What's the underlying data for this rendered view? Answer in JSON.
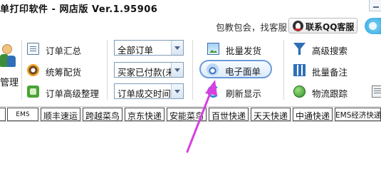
{
  "window": {
    "title": "单打印软件 - 网店版 Ver.1.95906",
    "minimize_icon": "minimize-icon"
  },
  "support": {
    "promo_text": "包教包会，找客服",
    "qq_button_label": "联系QQ客服",
    "qq_icon": "qq-penguin-icon"
  },
  "toolbar": {
    "manage_label": "管理",
    "left_tools": [
      {
        "label": "订单汇总",
        "icon": "document-list-icon"
      },
      {
        "label": "统筹配货",
        "icon": "gear-icon"
      },
      {
        "label": "订单高级整理",
        "icon": "organize-icon"
      }
    ],
    "filters": [
      {
        "value": "全部订单"
      },
      {
        "value": "买家已付款(未"
      },
      {
        "value": "订单成交时间,"
      }
    ],
    "middle_tools": [
      {
        "label": "批量发货",
        "icon": "image-icon"
      },
      {
        "label": "电子面单",
        "icon": "scanner-icon"
      },
      {
        "label": "刷新显示",
        "icon": "refresh-icon"
      }
    ],
    "right_tools": [
      {
        "label": "高级搜索",
        "icon": "funnel-icon"
      },
      {
        "label": "批量备注",
        "icon": "grid-icon"
      },
      {
        "label": "物流跟踪",
        "icon": "globe-icon"
      }
    ]
  },
  "courier_tabs": [
    {
      "label": "EMS"
    },
    {
      "label": "顺丰速运"
    },
    {
      "label": "跨越菜鸟"
    },
    {
      "label": "京东快递"
    },
    {
      "label": "安能菜鸟"
    },
    {
      "label": "百世快递"
    },
    {
      "label": "天天快递"
    },
    {
      "label": "中通快递"
    },
    {
      "label": "EMS经济快递"
    }
  ],
  "colors": {
    "highlight_border": "#6b9bd7",
    "annotation_arrow": "#d63fe0"
  }
}
